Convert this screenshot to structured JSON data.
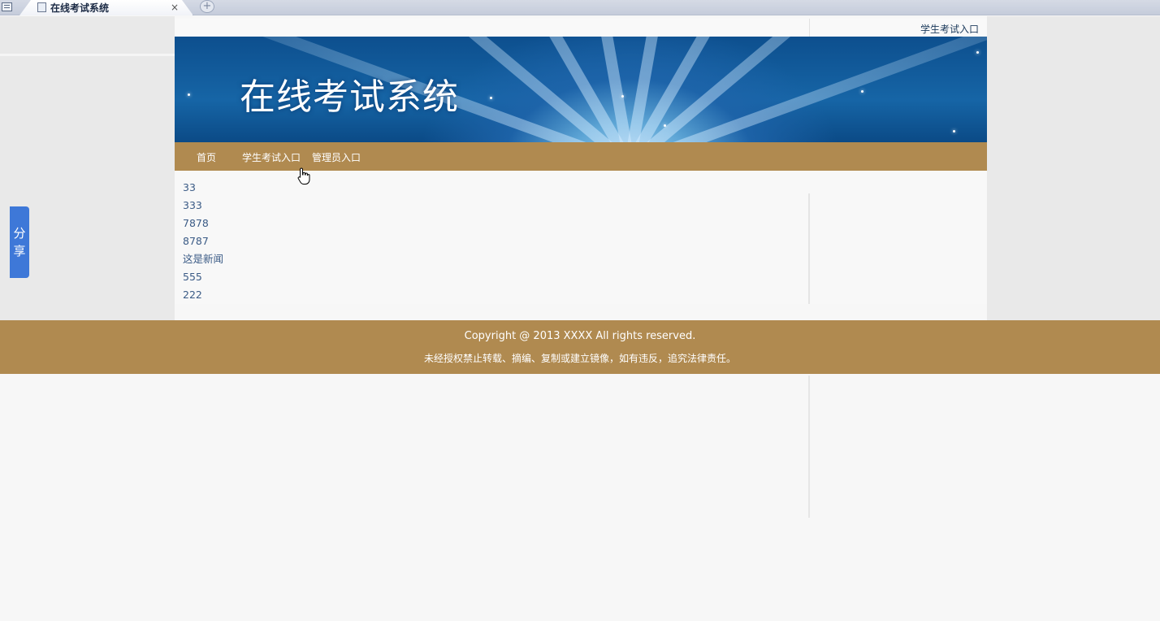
{
  "browser": {
    "tab_title": "在线考试系统",
    "tab_close": "×",
    "new_tab": "+"
  },
  "topbar": {
    "student_entry": "学生考试入口"
  },
  "banner": {
    "title": "在线考试系统"
  },
  "nav": {
    "items": [
      {
        "label": "首页"
      },
      {
        "label": "学生考试入口"
      },
      {
        "label": "管理员入口"
      }
    ]
  },
  "news": {
    "items": [
      "33",
      "333",
      "7878",
      "8787",
      "这是新闻",
      "555",
      "222"
    ]
  },
  "share": {
    "label_1": "分",
    "label_2": "享"
  },
  "footer": {
    "copyright": "Copyright @ 2013 XXXX All rights reserved.",
    "notice": "未经授权禁止转载、摘编、复制或建立镜像，如有违反，追究法律责任。"
  },
  "colors": {
    "nav_bg": "#b08a50",
    "share_bg": "#3e78d8",
    "link": "#3b5b86"
  }
}
